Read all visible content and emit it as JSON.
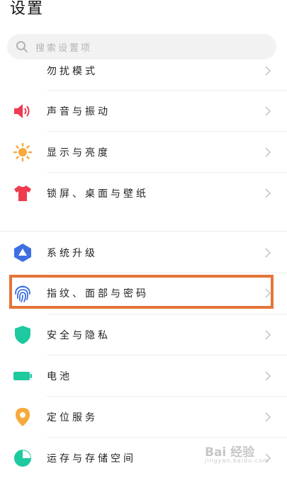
{
  "header": {
    "title": "设置"
  },
  "search": {
    "placeholder": "搜索设置项"
  },
  "items": [
    {
      "label": "勿扰模式",
      "icon": "moon-icon"
    },
    {
      "label": "声音与振动",
      "icon": "speaker-icon"
    },
    {
      "label": "显示与亮度",
      "icon": "sun-icon"
    },
    {
      "label": "锁屏、桌面与壁纸",
      "icon": "tshirt-icon"
    },
    {
      "label": "系统升级",
      "icon": "upgrade-icon"
    },
    {
      "label": "指纹、面部与密码",
      "icon": "fingerprint-icon"
    },
    {
      "label": "安全与隐私",
      "icon": "shield-icon"
    },
    {
      "label": "电池",
      "icon": "battery-icon"
    },
    {
      "label": "定位服务",
      "icon": "location-pin-icon"
    },
    {
      "label": "运存与存储空间",
      "icon": "pie-chart-icon"
    }
  ],
  "watermark": {
    "text": "Bai 经验",
    "sub": "jingyan.baidu.com"
  },
  "colors": {
    "highlight": "#e47438",
    "moon": "#b46ee6",
    "speaker": "#ee3b4f",
    "sun": "#f7a93a",
    "tshirt": "#ee3b4f",
    "upgrade": "#3d6fe0",
    "fingerprint": "#3d6fe0",
    "shield": "#1ec9a0",
    "battery": "#1ec9a0",
    "pin": "#f7a93a",
    "pie": "#1ec9a0"
  }
}
